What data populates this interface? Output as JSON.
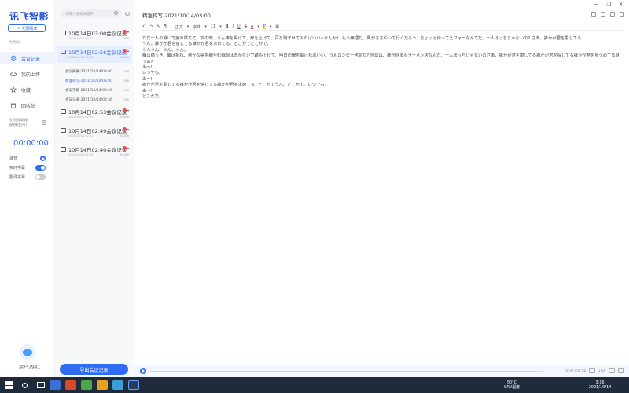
{
  "app": {
    "logo": "讯飞智影",
    "buy_label": "无限畅享",
    "plan_text": "免费用户",
    "doc_title": "精准转写-2021/10/14/03:00"
  },
  "window": {
    "minimize": "—",
    "restore": "❐",
    "close": "✕"
  },
  "sidebar": {
    "items": [
      {
        "label": "会议记录",
        "icon": "layers-icon"
      },
      {
        "label": "我的上传",
        "icon": "cloud-icon"
      },
      {
        "label": "收藏",
        "icon": "star-icon"
      },
      {
        "label": "回收站",
        "icon": "trash-icon"
      }
    ],
    "record_note": "讯飞智影助理\n随便聊会(AI)",
    "timer": "00:00:00",
    "options": [
      {
        "label": "录音"
      },
      {
        "label": "实时字幕"
      },
      {
        "label": "翻译字幕"
      }
    ],
    "username": "用户7941"
  },
  "list": {
    "search_placeholder": "请输入搜索关键字",
    "folders": [
      {
        "title": "10月14日03:00会议记录",
        "date": "2021/10/14 03:02",
        "size": "0KB"
      },
      {
        "title": "10月14日02:56会议记录",
        "date": "2021/10/14 02:58",
        "size": "929KB"
      },
      {
        "title": "10月14日02:53会议记录",
        "date": "2021/10/14 02:55",
        "size": "896KB"
      },
      {
        "title": "10月14日02:49会议记录",
        "date": "2021/10/14 02:51",
        "size": "824KB"
      },
      {
        "title": "10月14日02:40会议记录",
        "date": "2021/10/14 02:43",
        "size": "874KB"
      }
    ],
    "subitems": [
      {
        "label": "会议摘要-2021/10/14/03:00",
        "size": "1KB"
      },
      {
        "label": "精准转写-2021/10/14/03:00",
        "size": "1KB"
      },
      {
        "label": "会议字幕-2021/10/14/02:56",
        "size": "1KB"
      },
      {
        "label": "会议记录-2021/10/14/02:56",
        "size": "1KB"
      }
    ],
    "export_label": "导出会议记录"
  },
  "toolbar": {
    "undo": "↶",
    "redo": "↷",
    "brush": "✎",
    "format": "¶",
    "paragraph": "正文",
    "font": "字体",
    "size": "11",
    "bold": "B",
    "italic": "I",
    "underline": "U",
    "strike": "S",
    "color": "A",
    "highlight": "P",
    "table": "▦"
  },
  "content": {
    "text": "ただ一人の戦いで疲れ果てて、次の時、うん棒を掲げて、扉を上げて、戸を蹴ませてみればいい~なんか！ もう無理だ。風がささやいて行くだろう。ちょっと待ってえフォーなんでだ。一人ぼっちじゃないの? さあ、誰かが君を愛してる\nうん。誰かが君を信じてる誰かが君を求めてる、どこかでどこかで、\nうんうん、うん、うん。\n胸は痛っき、翼は折れ、愚かな夢を胸やむ戦闘は向かないで踏み上げて、明日の扉を開ければいい。うんロンピー何処た? 地球は、誰が話まるラーメン店なんだ、一人ぼっちじゃないのさあ、誰かが君を愛してる誰かが君を探してる誰かが君を見つめてる見つめ?\nあ〜!\nいつでも。\nあ〜!\n誰かが君を愛してる誰かが君を信じてる誰かが君を求めてる? どこかでうん、どこかで、いつでも。\nあ〜!\nどこかで。"
  },
  "player": {
    "time": "00:00 / 00:58",
    "speed": "1.0X"
  },
  "taskbar": {
    "weather": "50°C",
    "weather_sub": "CPU温度",
    "time": "3:16",
    "date": "2021/10/14"
  },
  "colors": {
    "accent": "#2e6cf6",
    "taskbar": "#1f2a3a",
    "active_bg": "#e6eeff"
  }
}
